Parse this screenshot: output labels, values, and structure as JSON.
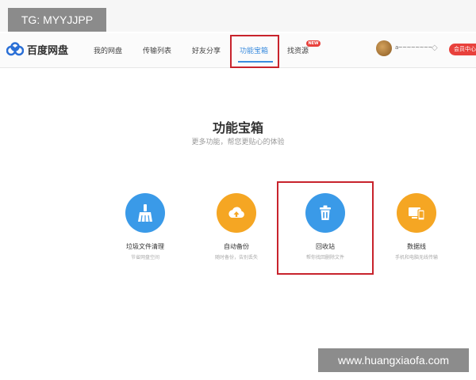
{
  "watermark": {
    "top_left": "TG: MYYJJPP",
    "bottom_right": "www.huangxiaofa.com"
  },
  "header": {
    "logo_text": "百度网盘",
    "nav": [
      "我的网盘",
      "传输列表",
      "好友分享",
      "功能宝箱",
      "找资源"
    ],
    "active_nav": "功能宝箱",
    "new_badge": "NEW",
    "username": "a~~~~~~~~",
    "vip_label": "会员中心"
  },
  "main": {
    "title": "功能宝箱",
    "subtitle": "更多功能，帮您更贴心的体验",
    "tools": [
      {
        "name": "垃圾文件清理",
        "desc": "节省网盘空间",
        "icon": "broom-icon",
        "color": "#3a9ae8"
      },
      {
        "name": "自动备份",
        "desc": "随时备份，告别丢失",
        "icon": "cloud-upload-icon",
        "color": "#f5a623"
      },
      {
        "name": "回收站",
        "desc": "帮你找回删除文件",
        "icon": "trash-icon",
        "color": "#3a9ae8"
      },
      {
        "name": "数据线",
        "desc": "手机和电脑无线传输",
        "icon": "devices-icon",
        "color": "#f5a623"
      }
    ]
  },
  "colors": {
    "accent": "#3b8cde",
    "highlight": "#c8232c",
    "badge": "#e8413c"
  }
}
